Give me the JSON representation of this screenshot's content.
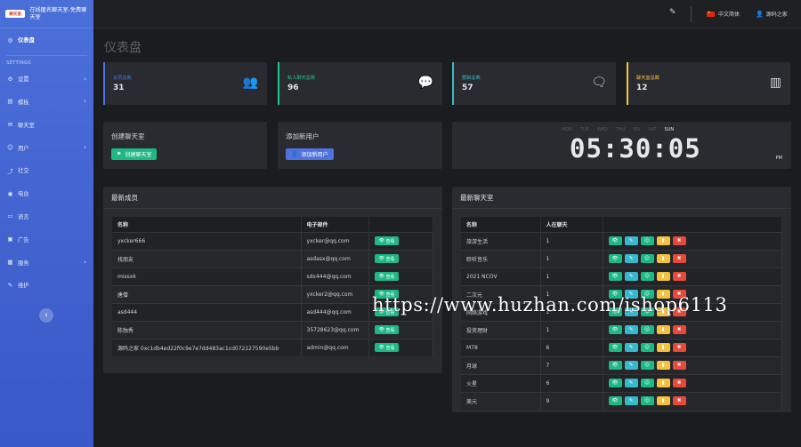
{
  "brand": {
    "logo_text": "聊天室",
    "title": "在线匿名聊天室-免费聊天室"
  },
  "sidebar": {
    "dashboard": "仪表盘",
    "section_heading": "SETTINGS",
    "items": [
      {
        "label": "设置",
        "icon": "gear-icon",
        "chevron": true
      },
      {
        "label": "模板",
        "icon": "template-icon",
        "chevron": true
      },
      {
        "label": "聊天室",
        "icon": "chat-icon",
        "chevron": false
      },
      {
        "label": "用户",
        "icon": "users-icon",
        "chevron": true
      },
      {
        "label": "社交",
        "icon": "share-icon",
        "chevron": false
      },
      {
        "label": "电台",
        "icon": "radio-icon",
        "chevron": false
      },
      {
        "label": "语言",
        "icon": "language-icon",
        "chevron": false
      },
      {
        "label": "广告",
        "icon": "ads-icon",
        "chevron": false
      },
      {
        "label": "服务",
        "icon": "server-icon",
        "chevron": true
      },
      {
        "label": "维护",
        "icon": "wrench-icon",
        "chevron": false
      }
    ],
    "collapse_glyph": "‹"
  },
  "topbar": {
    "language": "中文简体",
    "user": "源码之家"
  },
  "page_title": "仪表盘",
  "stats": [
    {
      "label": "会员总数",
      "value": "31",
      "color": "#4e73df",
      "icon": "users-icon"
    },
    {
      "label": "私人聊天总数",
      "value": "96",
      "color": "#1cc88a",
      "icon": "comment-dots-icon"
    },
    {
      "label": "群聊总数",
      "value": "57",
      "color": "#36b9cc",
      "icon": "comments-icon"
    },
    {
      "label": "聊天室总数",
      "value": "12",
      "color": "#f6c23e",
      "icon": "building-icon"
    }
  ],
  "actions": {
    "create_room": {
      "title": "创建聊天室",
      "button": "创建聊天室"
    },
    "add_user": {
      "title": "添加新用户",
      "button": "添加新用户"
    }
  },
  "clock": {
    "days": [
      "MON",
      "TUE",
      "WED",
      "THU",
      "FRI",
      "SAT",
      "SUN"
    ],
    "active_day": "SUN",
    "time": "05:30:05",
    "ampm": "PM"
  },
  "members": {
    "title": "最新成员",
    "headers": [
      "名称",
      "电子邮件",
      ""
    ],
    "view_label": "查看",
    "rows": [
      {
        "name": "yxcker666",
        "email": "yxcker@qq.com"
      },
      {
        "name": "找朋友",
        "email": "asdasx@qq.com"
      },
      {
        "name": "missxk",
        "email": "sdx444@qq.com"
      },
      {
        "name": "唐僧",
        "email": "yxcker2@qq.com"
      },
      {
        "name": "asd444",
        "email": "asd444@qq.com"
      },
      {
        "name": "陈独秀",
        "email": "35728623@qq.com"
      },
      {
        "name": "源码之家 0xc1db4ed22f0c9e7e7dd483ac1cd072127590e5bb",
        "email": "admin@qq.com"
      }
    ]
  },
  "rooms": {
    "title": "最新聊天室",
    "headers": [
      "名称",
      "人在聊天",
      ""
    ],
    "rows": [
      {
        "name": "旅游生活",
        "count": "1"
      },
      {
        "name": "聆听音乐",
        "count": "1"
      },
      {
        "name": "2021 NCOV",
        "count": "1"
      },
      {
        "name": "二次元",
        "count": "1"
      },
      {
        "name": "网络游戏",
        "count": "1"
      },
      {
        "name": "投资理财",
        "count": "1"
      },
      {
        "name": "M78",
        "count": "6"
      },
      {
        "name": "月球",
        "count": "7"
      },
      {
        "name": "火星",
        "count": "6"
      },
      {
        "name": "美元",
        "count": "9"
      }
    ]
  },
  "watermark": "https://www.huzhan.com/ishop6113"
}
